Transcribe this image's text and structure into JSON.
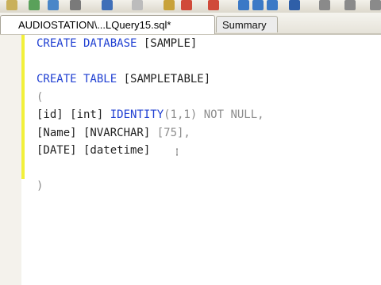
{
  "tabs": {
    "active_label": "AUDIOSTATION\\...LQuery15.sql*",
    "inactive_label": "Summary"
  },
  "editor": {
    "lines": [
      [
        {
          "t": "CREATE DATABASE",
          "c": "kw"
        },
        {
          "t": " [SAMPLE]",
          "c": "plain"
        }
      ],
      [],
      [
        {
          "t": "CREATE TABLE",
          "c": "kw"
        },
        {
          "t": " [SAMPLETABLE]",
          "c": "plain"
        }
      ],
      [
        {
          "t": "(",
          "c": "gray"
        }
      ],
      [
        {
          "t": "[id] [int] ",
          "c": "plain"
        },
        {
          "t": "IDENTITY",
          "c": "kw"
        },
        {
          "t": "(1,1) NOT NULL,",
          "c": "gray"
        }
      ],
      [
        {
          "t": "[Name] [NVARCHAR] ",
          "c": "plain"
        },
        {
          "t": "[75],",
          "c": "gray"
        }
      ],
      [
        {
          "t": "[DATE] [datetime]",
          "c": "plain"
        }
      ],
      [],
      [
        {
          "t": ")",
          "c": "gray"
        }
      ]
    ]
  },
  "colors": {
    "keyword": "#1f3fd2",
    "change_marker": "#f2f03a"
  }
}
